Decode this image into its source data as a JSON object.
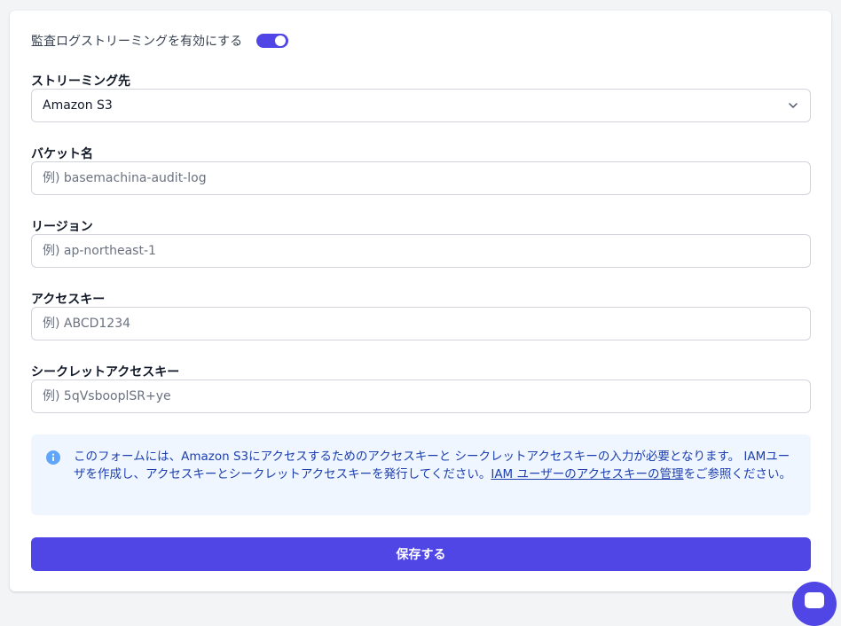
{
  "toggle": {
    "label": "監査ログストリーミングを有効にする",
    "enabled": true
  },
  "destination": {
    "label": "ストリーミング先",
    "value": "Amazon S3"
  },
  "bucket": {
    "label": "バケット名",
    "placeholder": "例) basemachina-audit-log",
    "value": ""
  },
  "region": {
    "label": "リージョン",
    "placeholder": "例) ap-northeast-1",
    "value": ""
  },
  "access_key": {
    "label": "アクセスキー",
    "placeholder": "例) ABCD1234",
    "value": ""
  },
  "secret_key": {
    "label": "シークレットアクセスキー",
    "placeholder": "例) 5qVsbooplSR+ye",
    "value": ""
  },
  "info": {
    "text_before": "このフォームには、Amazon S3にアクセスするためのアクセスキーと シークレットアクセスキーの入力が必要となります。 IAMユーザを作成し、アクセスキーとシークレットアクセスキーを発行してください。",
    "link_text": "IAM ユーザーのアクセスキーの管理",
    "text_after": "をご参照ください。"
  },
  "save_button": {
    "label": "保存する"
  },
  "icons": {
    "info": "info-circle-icon",
    "chevron": "chevron-down-icon",
    "chat": "chat-icon"
  },
  "colors": {
    "accent": "#4f46e5",
    "info_bg": "#eff6ff",
    "info_text": "#1e40af"
  }
}
